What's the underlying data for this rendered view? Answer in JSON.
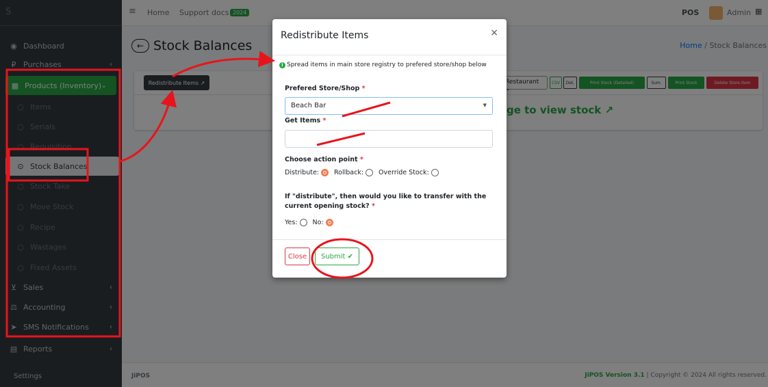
{
  "sidebar": {
    "brand": "S",
    "items": [
      {
        "label": "Dashboard",
        "icon": "dashboard-icon"
      },
      {
        "label": "Purchases",
        "icon": "ruble-icon"
      },
      {
        "label": "Products (Inventory)",
        "icon": "table-icon"
      },
      {
        "label": "Items"
      },
      {
        "label": "Serials"
      },
      {
        "label": "Requisition"
      },
      {
        "label": "Stock Balances"
      },
      {
        "label": "Stock Take"
      },
      {
        "label": "Move Stock"
      },
      {
        "label": "Recipe"
      },
      {
        "label": "Wastages"
      },
      {
        "label": "Fixed Assets"
      },
      {
        "label": "Sales",
        "icon": "cart-icon"
      },
      {
        "label": "Accounting",
        "icon": "scale-icon"
      },
      {
        "label": "SMS Notifications",
        "icon": "send-icon"
      },
      {
        "label": "Reports",
        "icon": "file-icon"
      }
    ],
    "settings": "Settings"
  },
  "topbar": {
    "home": "Home",
    "support": "Support docs",
    "badge": "2024",
    "pos": "POS",
    "user": "Admin"
  },
  "page": {
    "title": "Stock Balances",
    "breadcrumb_home": "Home",
    "breadcrumb_sep": "/",
    "breadcrumb_current": "Stock Balances",
    "redistribute_btn": "Redistribute Items",
    "store_select": "Restaurant",
    "btn_csv": "CSV",
    "btn_det": "Det.",
    "btn_print_detailed": "Print Stock (Detailed)",
    "btn_sum": "Sum.",
    "btn_print": "Print Stock",
    "btn_delete": "Delete Store Item",
    "view_stock": "ge to view stock"
  },
  "footer": {
    "left": "JiPOS",
    "brand": "JiPOS Version 3.1",
    "copyright": " | Copyright © 2024 All rights reserved."
  },
  "modal": {
    "title": "Redistribute Items",
    "close_x": "×",
    "info": "Spread items in main store registry to prefered store/shop below",
    "store_label": "Prefered Store/Shop",
    "store_value": "Beach Bar",
    "items_label": "Get Items",
    "action_label": "Choose action point",
    "opt_distribute": "Distribute:",
    "opt_rollback": "Rollback:",
    "opt_override": "Override Stock:",
    "transfer_q": "If \"distribute\", then would you like to transfer with the current opening stock?",
    "opt_yes": "Yes:",
    "opt_no": "No:",
    "close_btn": "Close",
    "submit_btn": "Submit"
  },
  "colors": {
    "accent": "#28a745",
    "danger": "#dc3545",
    "annotation": "#e8141c",
    "sidebar_bg": "#343a40"
  }
}
